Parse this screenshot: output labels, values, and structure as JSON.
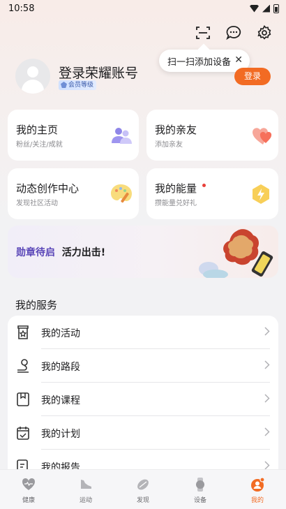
{
  "status_bar": {
    "time": "10:58"
  },
  "tooltip": {
    "text": "扫一扫添加设备",
    "close": "✕"
  },
  "profile": {
    "title": "登录荣耀账号",
    "badge": "会员等级",
    "login_button": "登录"
  },
  "cards": [
    {
      "title": "我的主页",
      "subtitle": "粉丝/关注/成就"
    },
    {
      "title": "我的亲友",
      "subtitle": "添加亲友"
    },
    {
      "title": "动态创作中心",
      "subtitle": "发现社区活动"
    },
    {
      "title": "我的能量",
      "subtitle": "攒能量兑好礼"
    }
  ],
  "banner": {
    "highlight": "勋章待启",
    "text": "活力出击!"
  },
  "services": {
    "title": "我的服务",
    "items": [
      {
        "label": "我的活动",
        "icon": "activity-icon"
      },
      {
        "label": "我的路段",
        "icon": "route-icon"
      },
      {
        "label": "我的课程",
        "icon": "course-icon"
      },
      {
        "label": "我的计划",
        "icon": "calendar-icon"
      },
      {
        "label": "我的报告",
        "icon": "report-icon"
      }
    ]
  },
  "tabs": [
    {
      "label": "健康",
      "icon": "heart-icon"
    },
    {
      "label": "运动",
      "icon": "shoe-icon"
    },
    {
      "label": "发现",
      "icon": "discover-icon"
    },
    {
      "label": "设备",
      "icon": "watch-icon"
    },
    {
      "label": "我的",
      "icon": "profile-icon",
      "active": true
    }
  ],
  "colors": {
    "accent": "#f26b23",
    "badge_blue": "#3a5aa8"
  }
}
